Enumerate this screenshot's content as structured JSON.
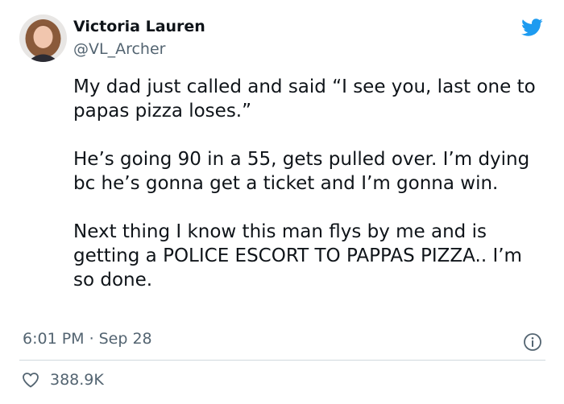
{
  "user": {
    "display_name": "Victoria Lauren",
    "handle": "@VL_Archer"
  },
  "tweet": {
    "paragraphs": [
      "My dad just called and said “I see you, last one to papas pizza loses.”",
      "He’s going 90 in a 55, gets pulled over. I’m dying bc he’s gonna get a ticket and I’m gonna win.",
      "Next thing I know this man flys by me and is getting a POLICE ESCORT TO PAPPAS PIZZA.. I’m so done."
    ],
    "time": "6:01 PM",
    "separator": "·",
    "date": "Sep 28"
  },
  "actions": {
    "like_count": "388.9K",
    "icons": [
      "heart-icon",
      "info-icon",
      "twitter-bird-icon"
    ]
  },
  "colors": {
    "brand": "#1d9bf0",
    "text": "#0f1419",
    "secondary": "#536471",
    "divider": "#cfd9de"
  }
}
